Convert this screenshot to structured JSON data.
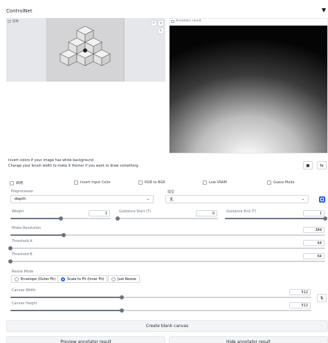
{
  "header": {
    "title": "ControlNet",
    "collapse_icon": "triangle-down-icon"
  },
  "left_image": {
    "tag": "图像",
    "brush_icon": "undo-icon",
    "close_icon": "close-icon",
    "pencil_icon": "pencil-icon"
  },
  "right_image": {
    "tag": "Annotator result"
  },
  "hints": {
    "line1": "Invert colors if your image has white background.",
    "line2": "Change your brush width to make it thinner if you want to draw something."
  },
  "checkboxes": [
    {
      "label": "启用",
      "checked": false
    },
    {
      "label": "Invert Input Color",
      "checked": false
    },
    {
      "label": "RGB to BGR",
      "checked": false
    },
    {
      "label": "Low VRAM",
      "checked": false
    },
    {
      "label": "Guess Mode",
      "checked": false
    }
  ],
  "preprocessor": {
    "label": "Preprocessor",
    "value": "depth"
  },
  "model": {
    "label": "模型",
    "value": "无"
  },
  "weight": {
    "label": "Weight",
    "value": "1",
    "fraction": 0.5
  },
  "guidance_start": {
    "label": "Guidance Start (T)",
    "value": "0",
    "fraction": 0
  },
  "guidance_end": {
    "label": "Guidance End (T)",
    "value": "1",
    "fraction": 1
  },
  "midas": {
    "label": "Midas Resolution",
    "value": "384",
    "fraction": 0.17
  },
  "threshold_a": {
    "label": "Threshold A",
    "value": "64",
    "fraction": 0
  },
  "threshold_b": {
    "label": "Threshold B",
    "value": "64",
    "fraction": 0
  },
  "resize_mode": {
    "label": "Resize Mode",
    "options": [
      "Envelope (Outer Fit)",
      "Scale to Fit (Inner Fit)",
      "Just Resize"
    ],
    "selected": 1
  },
  "canvas_width": {
    "label": "Canvas Width",
    "value": "512",
    "fraction": 0.37
  },
  "canvas_height": {
    "label": "Canvas Height",
    "value": "512",
    "fraction": 0.37
  },
  "buttons": {
    "create_canvas": "Create blank canvas",
    "preview": "Preview annotator result",
    "hide": "Hide annotator result"
  }
}
